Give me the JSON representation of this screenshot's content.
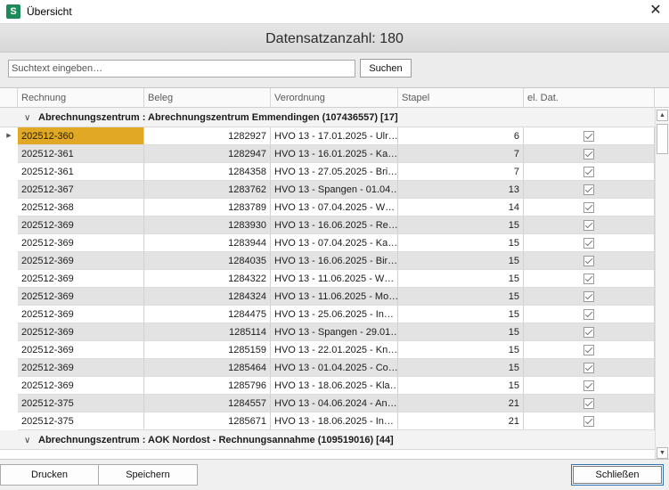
{
  "window": {
    "app_icon_letter": "S",
    "title": "Übersicht",
    "close_glyph": "✕"
  },
  "summary": {
    "record_count_text": "Datensatzanzahl: 180"
  },
  "search": {
    "placeholder": "Suchtext eingeben…",
    "value": "",
    "button_label": "Suchen"
  },
  "grid": {
    "columns": [
      "Rechnung",
      "Beleg",
      "Verordnung",
      "Stapel",
      "el. Dat."
    ],
    "groups": [
      {
        "label": "Abrechnungszentrum : Abrechnungszentrum Emmendingen (107436557) [17]",
        "rows": [
          {
            "rechnung": "202512-360",
            "beleg": "1282927",
            "verordnung": "HVO 13 - 17.01.2025 - Ulr…",
            "stapel": "6",
            "el_dat": true,
            "selected": true
          },
          {
            "rechnung": "202512-361",
            "beleg": "1282947",
            "verordnung": "HVO 13 - 16.01.2025 - Ka…",
            "stapel": "7",
            "el_dat": true
          },
          {
            "rechnung": "202512-361",
            "beleg": "1284358",
            "verordnung": "HVO 13 - 27.05.2025 - Bri…",
            "stapel": "7",
            "el_dat": true
          },
          {
            "rechnung": "202512-367",
            "beleg": "1283762",
            "verordnung": "HVO 13 - Spangen - 01.04…",
            "stapel": "13",
            "el_dat": true
          },
          {
            "rechnung": "202512-368",
            "beleg": "1283789",
            "verordnung": "HVO 13 - 07.04.2025 - W…",
            "stapel": "14",
            "el_dat": true
          },
          {
            "rechnung": "202512-369",
            "beleg": "1283930",
            "verordnung": "HVO 13 - 16.06.2025 - Re…",
            "stapel": "15",
            "el_dat": true
          },
          {
            "rechnung": "202512-369",
            "beleg": "1283944",
            "verordnung": "HVO 13 - 07.04.2025 - Ka…",
            "stapel": "15",
            "el_dat": true
          },
          {
            "rechnung": "202512-369",
            "beleg": "1284035",
            "verordnung": "HVO 13 - 16.06.2025 - Bir…",
            "stapel": "15",
            "el_dat": true
          },
          {
            "rechnung": "202512-369",
            "beleg": "1284322",
            "verordnung": "HVO 13 - 11.06.2025 - W…",
            "stapel": "15",
            "el_dat": true
          },
          {
            "rechnung": "202512-369",
            "beleg": "1284324",
            "verordnung": "HVO 13 - 11.06.2025 - Mo…",
            "stapel": "15",
            "el_dat": true
          },
          {
            "rechnung": "202512-369",
            "beleg": "1284475",
            "verordnung": "HVO 13 - 25.06.2025 - In…",
            "stapel": "15",
            "el_dat": true
          },
          {
            "rechnung": "202512-369",
            "beleg": "1285114",
            "verordnung": "HVO 13 - Spangen - 29.01…",
            "stapel": "15",
            "el_dat": true
          },
          {
            "rechnung": "202512-369",
            "beleg": "1285159",
            "verordnung": "HVO 13 - 22.01.2025 - Kn…",
            "stapel": "15",
            "el_dat": true
          },
          {
            "rechnung": "202512-369",
            "beleg": "1285464",
            "verordnung": "HVO 13 - 01.04.2025 - Co…",
            "stapel": "15",
            "el_dat": true
          },
          {
            "rechnung": "202512-369",
            "beleg": "1285796",
            "verordnung": "HVO 13 - 18.06.2025 - Kla…",
            "stapel": "15",
            "el_dat": true
          },
          {
            "rechnung": "202512-375",
            "beleg": "1284557",
            "verordnung": "HVO 13 - 04.06.2024 - An…",
            "stapel": "21",
            "el_dat": true
          },
          {
            "rechnung": "202512-375",
            "beleg": "1285671",
            "verordnung": "HVO 13 - 18.06.2025 - In…",
            "stapel": "21",
            "el_dat": true
          }
        ]
      },
      {
        "label": "Abrechnungszentrum : AOK Nordost - Rechnungsannahme (109519016) [44]",
        "rows": []
      }
    ]
  },
  "icons": {
    "row_indicator": "row-pointer-icon",
    "group_toggle": "chevron-down-icon",
    "check": "checkmark-icon",
    "scroll_up": "arrow-up-icon",
    "scroll_down": "arrow-down-icon"
  },
  "colors": {
    "selected_cell": "#e0a824",
    "alt_row": "#e3e3e3",
    "app_icon": "#1e8a5c"
  },
  "footer": {
    "print_label": "Drucken",
    "save_label": "Speichern",
    "close_label": "Schließen"
  }
}
